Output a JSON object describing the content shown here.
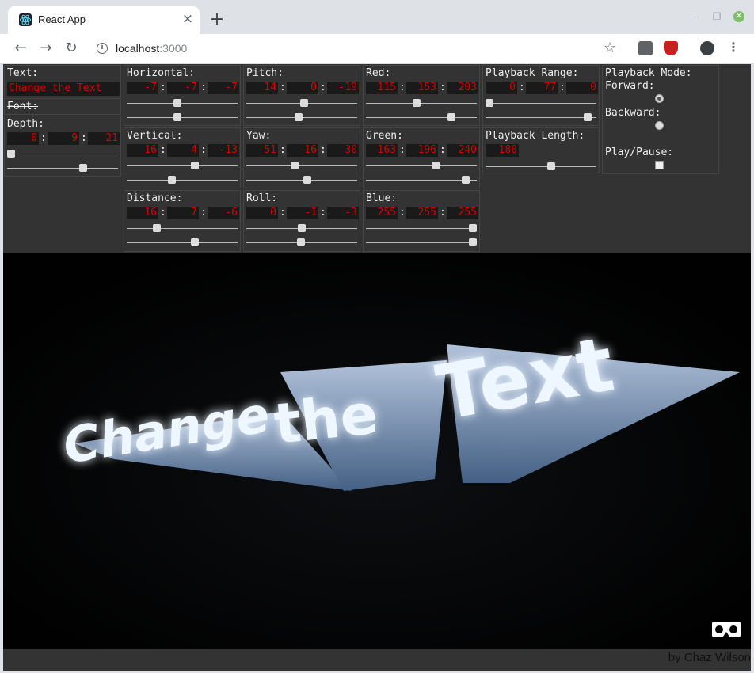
{
  "browser": {
    "tab_title": "React App",
    "tab_close": "×",
    "new_tab": "+",
    "url_host": "localhost",
    "url_port": ":3000",
    "window_controls": [
      "–",
      "❐",
      "✕"
    ]
  },
  "controls": {
    "text": {
      "label": "Text:",
      "value": "Change the Text"
    },
    "font": {
      "label": "Font:"
    },
    "depth": {
      "label": "Depth:",
      "values": [
        "0",
        "9",
        "21"
      ],
      "sliders": [
        0.0,
        0.7
      ]
    },
    "horizontal": {
      "label": "Horizontal:",
      "values": [
        "-7",
        "-7",
        "-7"
      ],
      "sliders": [
        0.45,
        0.45
      ]
    },
    "vertical": {
      "label": "Vertical:",
      "values": [
        "16",
        "4",
        "-13"
      ],
      "sliders": [
        0.62,
        0.4
      ]
    },
    "distance": {
      "label": "Distance:",
      "values": [
        "16",
        "7",
        "-6"
      ],
      "sliders": [
        0.25,
        0.62
      ]
    },
    "pitch": {
      "label": "Pitch:",
      "values": [
        "14",
        "0",
        "-19"
      ],
      "sliders": [
        0.52,
        0.47
      ]
    },
    "yaw": {
      "label": "Yaw:",
      "values": [
        "-51",
        "-16",
        "30"
      ],
      "sliders": [
        0.43,
        0.55
      ]
    },
    "roll": {
      "label": "Roll:",
      "values": [
        "0",
        "-1",
        "-3"
      ],
      "sliders": [
        0.5,
        0.49
      ]
    },
    "red": {
      "label": "Red:",
      "values": [
        "115",
        "153",
        "203"
      ],
      "sliders": [
        0.45,
        0.79
      ]
    },
    "green": {
      "label": "Green:",
      "values": [
        "163",
        "196",
        "240"
      ],
      "sliders": [
        0.64,
        0.93
      ]
    },
    "blue": {
      "label": "Blue:",
      "values": [
        "255",
        "255",
        "255"
      ],
      "sliders": [
        1.0,
        1.0
      ]
    },
    "playback_range": {
      "label": "Playback Range:",
      "values": [
        "0",
        "77",
        "0"
      ],
      "sliders": [
        0.0,
        0.95
      ]
    },
    "playback_length": {
      "label": "Playback Length:",
      "value": "180",
      "slider": 0.6
    },
    "playback_mode": {
      "label": "Playback Mode:",
      "forward": "Forward:",
      "backward": "Backward:",
      "selected": "forward"
    },
    "play_pause": {
      "label": "Play/Pause:",
      "checked": false
    }
  },
  "scene": {
    "text": "Change the Text"
  },
  "footer": {
    "credit": "by Chaz Wilson"
  },
  "colors": {
    "value_red": "#d40000",
    "panel_bg": "#333333",
    "scene_bg": "#020202",
    "glow": "#b8d8ff"
  }
}
